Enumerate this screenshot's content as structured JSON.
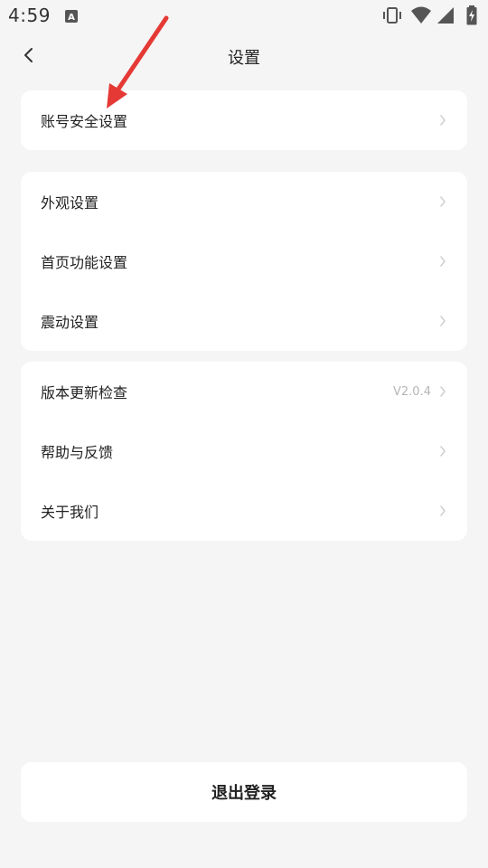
{
  "status_bar": {
    "time": "4:59",
    "icons": [
      "android-a-icon",
      "vibrate-icon",
      "wifi-icon",
      "signal-icon",
      "battery-charging-icon"
    ]
  },
  "header": {
    "title": "设置",
    "back_icon": "chevron-left-icon"
  },
  "groups": [
    {
      "items": [
        {
          "label": "账号安全设置",
          "value": ""
        }
      ]
    },
    {
      "items": [
        {
          "label": "外观设置",
          "value": ""
        },
        {
          "label": "首页功能设置",
          "value": ""
        },
        {
          "label": "震动设置",
          "value": ""
        }
      ]
    },
    {
      "items": [
        {
          "label": "版本更新检查",
          "value": "V2.0.4"
        },
        {
          "label": "帮助与反馈",
          "value": ""
        },
        {
          "label": "关于我们",
          "value": ""
        }
      ]
    }
  ],
  "logout": {
    "label": "退出登录"
  },
  "colors": {
    "background": "#f5f5f5",
    "card": "#ffffff",
    "text": "#222222",
    "muted": "#b5b5b5",
    "annotation_arrow": "#e53935"
  }
}
